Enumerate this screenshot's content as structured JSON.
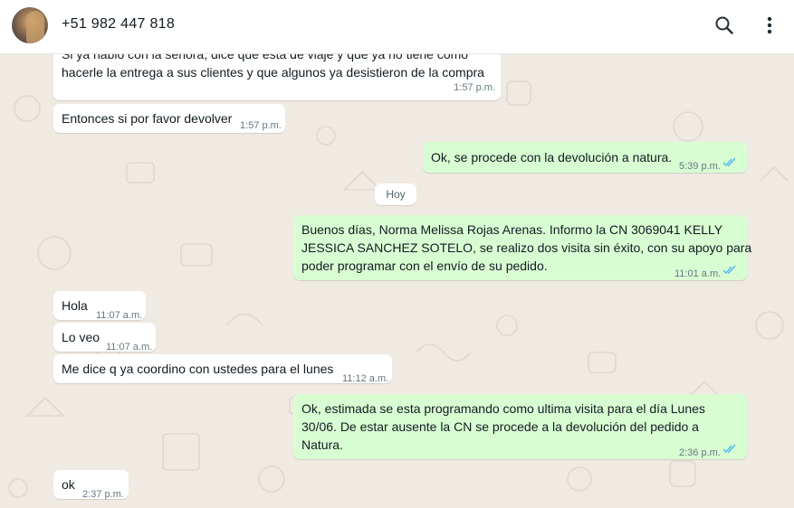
{
  "header": {
    "contact_name": "+51 982 447 818",
    "search_icon": "search-icon",
    "menu_icon": "kebab-menu-icon"
  },
  "colors": {
    "header_bg": "#ffffff",
    "chat_bg": "#efeae2",
    "incoming_bubble": "#ffffff",
    "outgoing_bubble": "#d9fdd3",
    "read_ticks": "#53bdeb"
  },
  "day_separator": "Hoy",
  "messages": [
    {
      "direction": "in",
      "lines": [
        "Si ya habló con la señora, dice que está de viaje y que ya no tiene cómo",
        "hacerle la entrega a sus clientes y que algunos ya desistieron de la compra"
      ],
      "time": "1:57 p.m."
    },
    {
      "direction": "in",
      "lines": [
        "Entonces si por favor devolver"
      ],
      "time": "1:57 p.m."
    },
    {
      "direction": "out",
      "lines": [
        "Ok, se procede con la devolución a natura."
      ],
      "time": "5:39 p.m.",
      "status": "read"
    },
    {
      "direction": "out",
      "lines": [
        "Buenos días, Norma Melissa Rojas Arenas. Informo la CN 3069041 KELLY",
        "JESSICA SANCHEZ SOTELO, se realizo dos visita sin éxito, con su apoyo para",
        "poder programar con el envío de su pedido."
      ],
      "time": "11:01 a.m.",
      "status": "read"
    },
    {
      "direction": "in",
      "lines": [
        "Hola"
      ],
      "time": "11:07 a.m."
    },
    {
      "direction": "in",
      "lines": [
        "Lo veo"
      ],
      "time": "11:07 a.m."
    },
    {
      "direction": "in",
      "lines": [
        "Me dice q ya coordino con ustedes para el lunes"
      ],
      "time": "11:12 a.m."
    },
    {
      "direction": "out",
      "lines": [
        "Ok, estimada se esta programando como ultima visita para el día Lunes",
        "30/06. De estar ausente la CN se procede a la devolución del pedido a",
        "Natura."
      ],
      "time": "2:36 p.m.",
      "status": "read"
    },
    {
      "direction": "in",
      "lines": [
        "ok"
      ],
      "time": "2:37 p.m."
    }
  ]
}
